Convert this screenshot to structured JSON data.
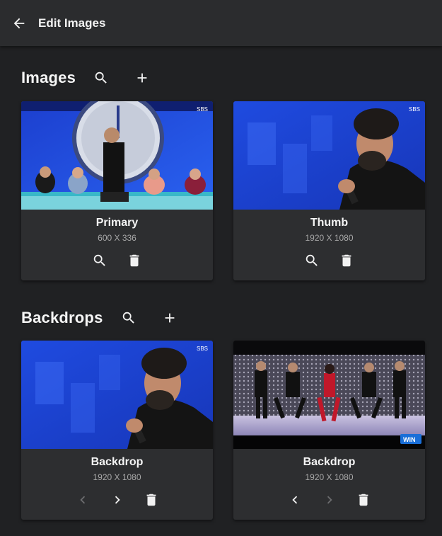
{
  "header": {
    "title": "Edit Images"
  },
  "images_section": {
    "title": "Images",
    "cards": [
      {
        "name": "Primary",
        "dims": "600 X 336"
      },
      {
        "name": "Thumb",
        "dims": "1920 X 1080"
      }
    ]
  },
  "backdrops_section": {
    "title": "Backdrops",
    "cards": [
      {
        "name": "Backdrop",
        "dims": "1920 X 1080"
      },
      {
        "name": "Backdrop",
        "dims": "1920 X 1080"
      }
    ]
  },
  "thumb_badges": {
    "channel": "SBS",
    "corner": "WIN"
  },
  "colors": {
    "background": "#202123",
    "header": "#2b2c2e",
    "card": "#2d2e30",
    "thumb_blue": "#1e46d8"
  },
  "icons": {
    "back": "arrow-left-icon",
    "search": "search-icon",
    "add": "plus-icon",
    "delete": "trash-icon",
    "previous": "chevron-left-icon",
    "next": "chevron-right-icon"
  }
}
